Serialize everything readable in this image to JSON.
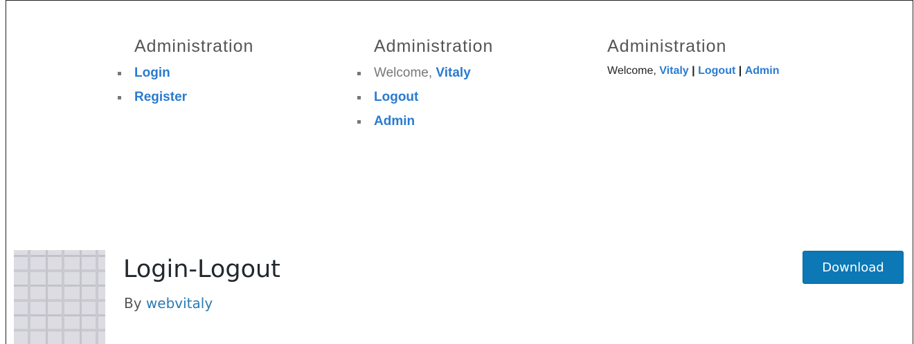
{
  "banner": {
    "columns": [
      {
        "heading": "Administration",
        "items": [
          {
            "label": "Login"
          },
          {
            "label": "Register"
          }
        ]
      },
      {
        "heading": "Administration",
        "welcome_prefix": "Welcome,",
        "welcome_user": "Vitaly",
        "items": [
          {
            "label": "Logout"
          },
          {
            "label": "Admin"
          }
        ]
      },
      {
        "heading": "Administration",
        "welcome_prefix": "Welcome,",
        "welcome_user": "Vitaly",
        "separator": "|",
        "logout": "Logout",
        "admin": "Admin"
      }
    ]
  },
  "plugin": {
    "title": "Login-Logout",
    "by_prefix": "By",
    "author": "webvitaly",
    "download_label": "Download"
  },
  "colors": {
    "link": "#2a7bd0",
    "button": "#0c78b5"
  }
}
